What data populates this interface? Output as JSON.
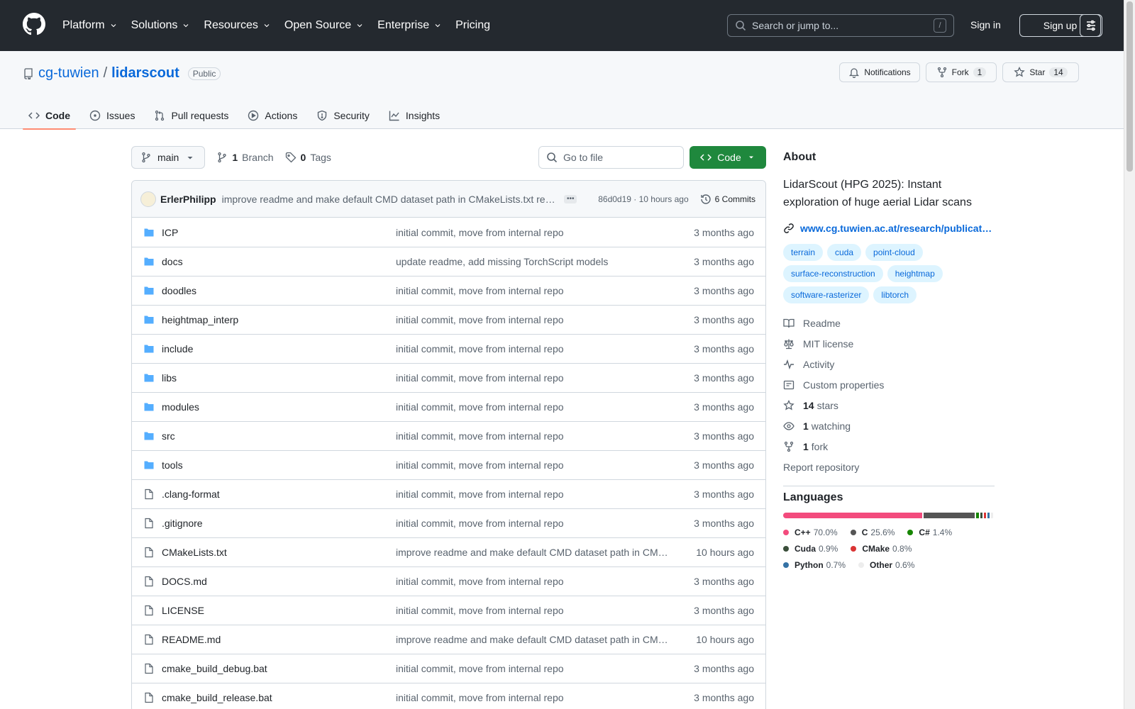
{
  "header": {
    "nav": [
      "Platform",
      "Solutions",
      "Resources",
      "Open Source",
      "Enterprise",
      "Pricing"
    ],
    "search_placeholder": "Search or jump to...",
    "search_key": "/",
    "signin": "Sign in",
    "signup": "Sign up"
  },
  "repo": {
    "owner": "cg-tuwien",
    "sep": "/",
    "name": "lidarscout",
    "visibility": "Public",
    "notifications": "Notifications",
    "fork_label": "Fork",
    "fork_count": "1",
    "star_label": "Star",
    "star_count": "14"
  },
  "tabs": [
    "Code",
    "Issues",
    "Pull requests",
    "Actions",
    "Security",
    "Insights"
  ],
  "toolbar": {
    "branch": "main",
    "branch_count": "1",
    "branch_label": "Branch",
    "tag_count": "0",
    "tag_label": "Tags",
    "goto_placeholder": "Go to file",
    "code_button": "Code"
  },
  "commit": {
    "author": "ErlerPhilipp",
    "message": "improve readme and make default CMD dataset path in CMakeLists.txt re…",
    "sha_time": "86d0d19 · 10 hours ago",
    "count": "6 Commits"
  },
  "files": [
    {
      "name": "ICP",
      "type": "dir",
      "msg": "initial commit, move from internal repo",
      "date": "3 months ago"
    },
    {
      "name": "docs",
      "type": "dir",
      "msg": "update readme, add missing TorchScript models",
      "date": "3 months ago"
    },
    {
      "name": "doodles",
      "type": "dir",
      "msg": "initial commit, move from internal repo",
      "date": "3 months ago"
    },
    {
      "name": "heightmap_interp",
      "type": "dir",
      "msg": "initial commit, move from internal repo",
      "date": "3 months ago"
    },
    {
      "name": "include",
      "type": "dir",
      "msg": "initial commit, move from internal repo",
      "date": "3 months ago"
    },
    {
      "name": "libs",
      "type": "dir",
      "msg": "initial commit, move from internal repo",
      "date": "3 months ago"
    },
    {
      "name": "modules",
      "type": "dir",
      "msg": "initial commit, move from internal repo",
      "date": "3 months ago"
    },
    {
      "name": "src",
      "type": "dir",
      "msg": "initial commit, move from internal repo",
      "date": "3 months ago"
    },
    {
      "name": "tools",
      "type": "dir",
      "msg": "initial commit, move from internal repo",
      "date": "3 months ago"
    },
    {
      "name": ".clang-format",
      "type": "file",
      "msg": "initial commit, move from internal repo",
      "date": "3 months ago"
    },
    {
      "name": ".gitignore",
      "type": "file",
      "msg": "initial commit, move from internal repo",
      "date": "3 months ago"
    },
    {
      "name": "CMakeLists.txt",
      "type": "file",
      "msg": "improve readme and make default CMD dataset path in CM…",
      "date": "10 hours ago"
    },
    {
      "name": "DOCS.md",
      "type": "file",
      "msg": "initial commit, move from internal repo",
      "date": "3 months ago"
    },
    {
      "name": "LICENSE",
      "type": "file",
      "msg": "initial commit, move from internal repo",
      "date": "3 months ago"
    },
    {
      "name": "README.md",
      "type": "file",
      "msg": "improve readme and make default CMD dataset path in CM…",
      "date": "10 hours ago"
    },
    {
      "name": "cmake_build_debug.bat",
      "type": "file",
      "msg": "initial commit, move from internal repo",
      "date": "3 months ago"
    },
    {
      "name": "cmake_build_release.bat",
      "type": "file",
      "msg": "initial commit, move from internal repo",
      "date": "3 months ago"
    }
  ],
  "about": {
    "title": "About",
    "description": "LidarScout (HPG 2025): Instant exploration of huge aerial Lidar scans",
    "link": "www.cg.tuwien.ac.at/research/publicat…",
    "topics": [
      "terrain",
      "cuda",
      "point-cloud",
      "surface-reconstruction",
      "heightmap",
      "software-rasterizer",
      "libtorch"
    ],
    "readme": "Readme",
    "license": "MIT license",
    "activity": "Activity",
    "custom_props": "Custom properties",
    "stars_count": "14",
    "stars_label": "stars",
    "watching_count": "1",
    "watching_label": "watching",
    "fork_count": "1",
    "fork_label": "fork",
    "report": "Report repository"
  },
  "languages": {
    "title": "Languages",
    "items": [
      {
        "name": "C++",
        "pct": "70.0%",
        "value": 70.0,
        "color": "#f34b7d"
      },
      {
        "name": "C",
        "pct": "25.6%",
        "value": 25.6,
        "color": "#555555"
      },
      {
        "name": "C#",
        "pct": "1.4%",
        "value": 1.4,
        "color": "#178600"
      },
      {
        "name": "Cuda",
        "pct": "0.9%",
        "value": 0.9,
        "color": "#3a4e3a"
      },
      {
        "name": "CMake",
        "pct": "0.8%",
        "value": 0.8,
        "color": "#da3434"
      },
      {
        "name": "Python",
        "pct": "0.7%",
        "value": 0.7,
        "color": "#3572a5"
      },
      {
        "name": "Other",
        "pct": "0.6%",
        "value": 0.6,
        "color": "#ededed"
      }
    ]
  }
}
